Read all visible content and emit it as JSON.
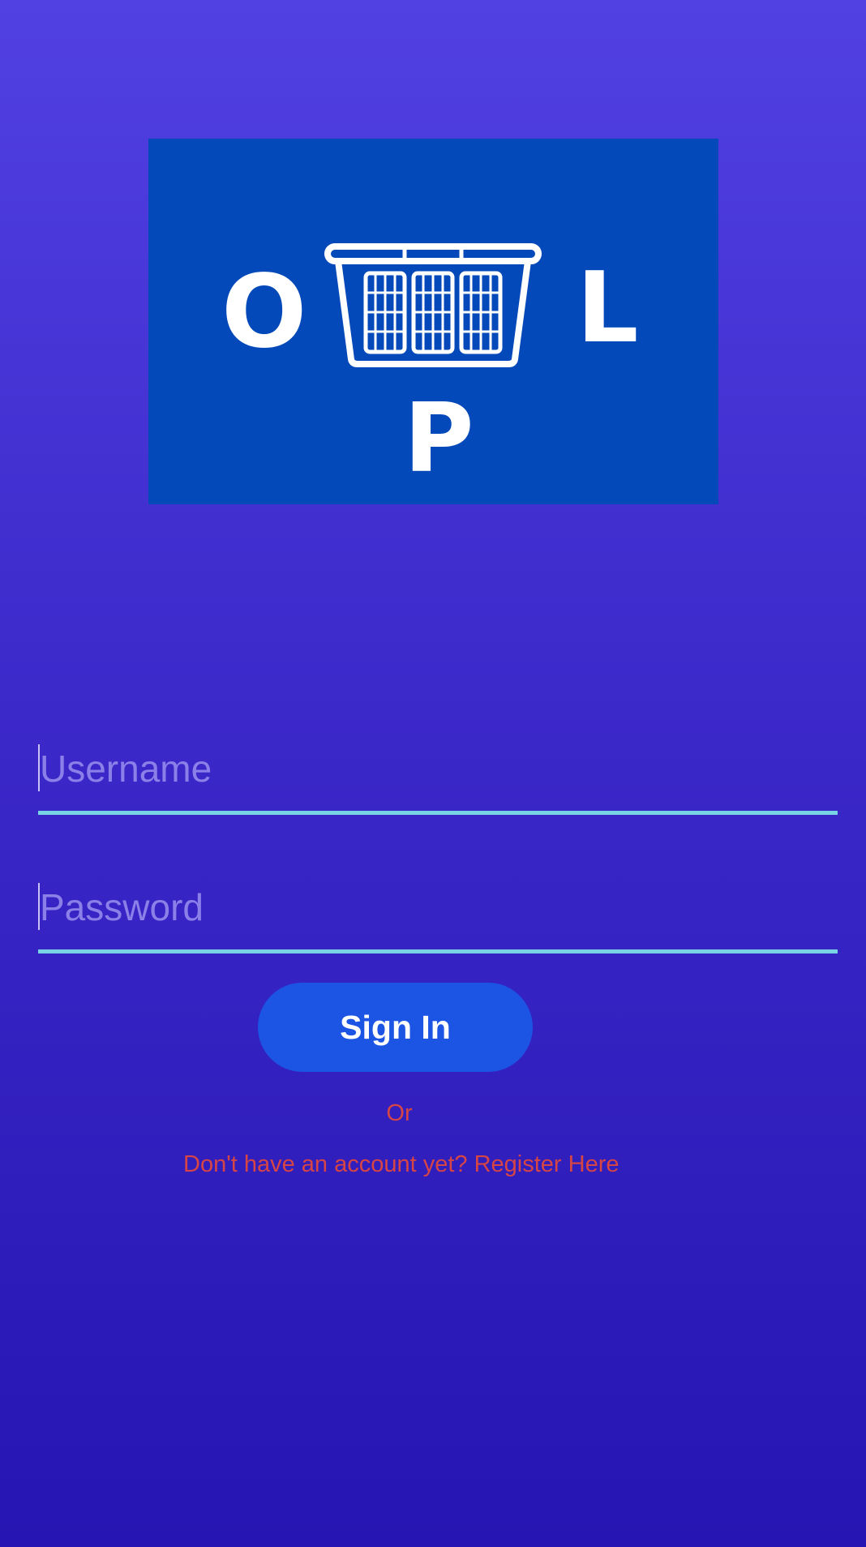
{
  "logo": {
    "letters": {
      "o": "O",
      "l": "L",
      "p": "P"
    },
    "icon": "laundry-basket-icon",
    "background_color": "#0449B9"
  },
  "form": {
    "username": {
      "placeholder": "Username",
      "value": ""
    },
    "password": {
      "placeholder": "Password",
      "value": ""
    },
    "sign_in_label": "Sign In",
    "or_text": "Or",
    "register_link": "Don't have an account yet? Register Here"
  },
  "colors": {
    "background_top": "#5140E2",
    "background_bottom": "#2615B2",
    "underline": "#7AD3E5",
    "button": "#1C55E3",
    "link_text": "#D64545"
  }
}
